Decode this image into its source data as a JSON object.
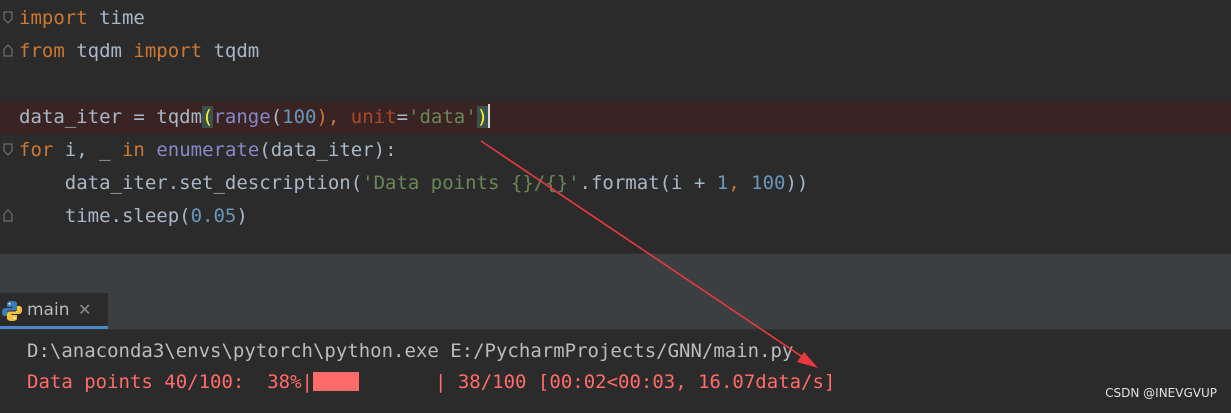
{
  "editor": {
    "lines": {
      "l1": {
        "kw": "import",
        "rest": " time"
      },
      "l2": {
        "kw1": "from",
        "mod": " tqdm ",
        "kw2": "import",
        "rest": " tqdm"
      },
      "l4": {
        "pre": "data_iter = tqdm",
        "open": "(",
        "fn": "range",
        "p1": "(",
        "n1": "100",
        "p2": "), ",
        "param": "unit",
        "eq": "=",
        "str": "'data'",
        "close": ")"
      },
      "l5": {
        "kw": "for",
        "mid": " i, _ ",
        "kw2": "in",
        "sp": " ",
        "fn": "enumerate",
        "rest": "(data_iter):"
      },
      "l6": {
        "indent": "    data_iter.set_description(",
        "str": "'Data points {}/{}'",
        "mid": ".format(i + ",
        "n1": "1",
        "comma": ", ",
        "n2": "100",
        "end": "))"
      },
      "l7": {
        "indent": "    time.sleep(",
        "num": "0.05",
        "end": ")"
      }
    }
  },
  "run": {
    "tab_label": "main",
    "close_glyph": "✕",
    "command": "D:\\anaconda3\\envs\\pytorch\\python.exe E:/PycharmProjects/GNN/main.py",
    "progress": {
      "prefix": "Data points 40/100:  38%|",
      "fraction": 0.38,
      "suffix": "| 38/100 [00:02<00:03, 16.07data/s]"
    }
  },
  "watermark": "CSDN @INEVGVUP",
  "colors": {
    "keyword": "#cc7832",
    "builtin": "#8888c6",
    "number": "#6897bb",
    "string": "#6a8759",
    "param": "#aa4926",
    "stderr": "#ff6b68",
    "annotation_arrow": "#e8383d"
  }
}
